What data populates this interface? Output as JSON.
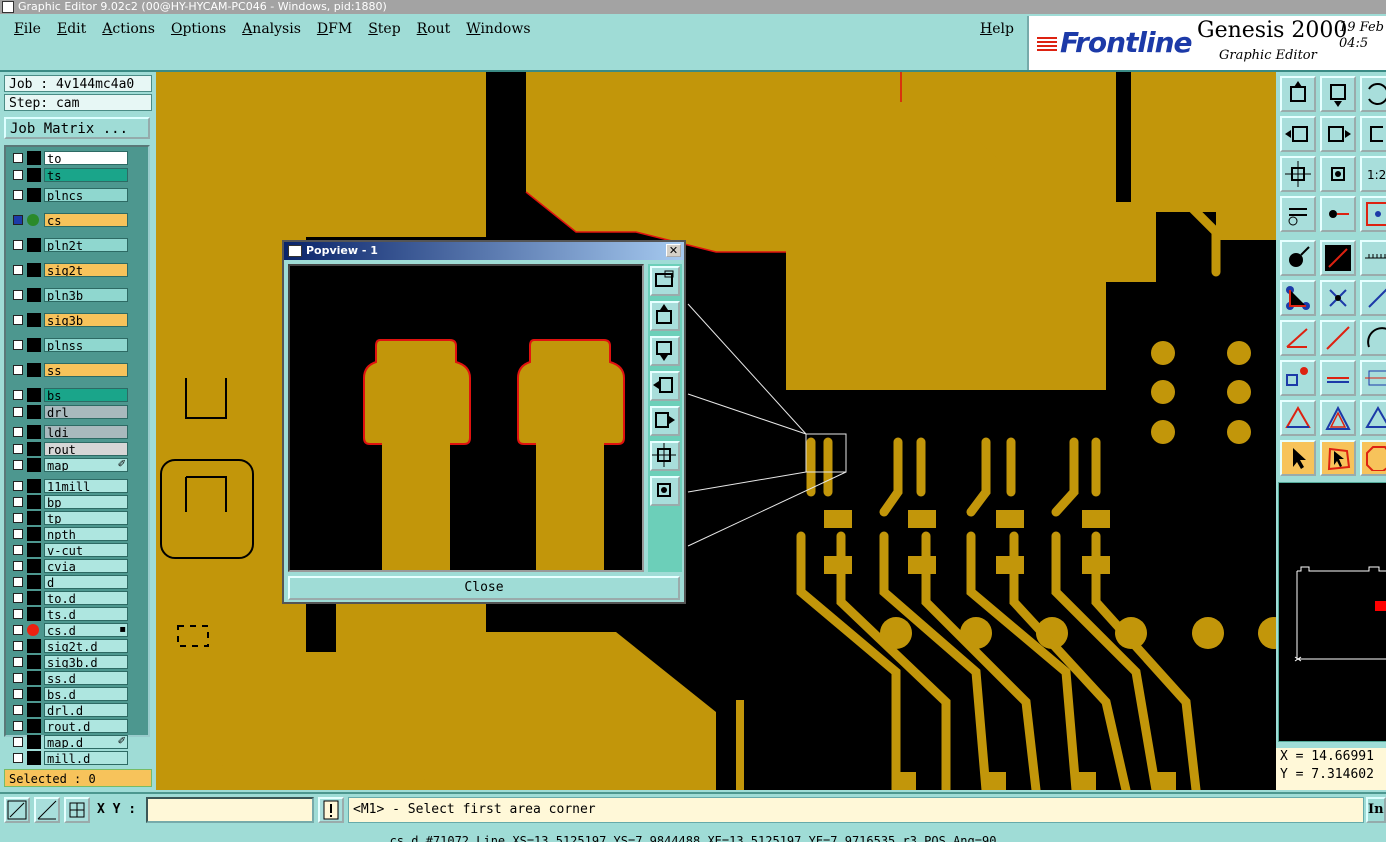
{
  "window": {
    "title": "Graphic Editor 9.02c2 (00@HY-HYCAM-PC046 - Windows, pid:1880)"
  },
  "menubar": {
    "items": [
      "File",
      "Edit",
      "Actions",
      "Options",
      "Analysis",
      "DFM",
      "Step",
      "Rout",
      "Windows"
    ],
    "help": "Help"
  },
  "brand": {
    "logo": "Frontline",
    "product": "Genesis 2000",
    "subtitle": "Graphic Editor",
    "date": "19 Feb",
    "time": "04:5"
  },
  "job": {
    "job": "Job : 4v144mc4a0",
    "step": "Step: cam",
    "matrix_button": "Job Matrix ..."
  },
  "layers": [
    {
      "name": "to",
      "color": "white",
      "marker": "black"
    },
    {
      "name": "ts",
      "color": "green",
      "marker": "black"
    },
    {
      "name": "plncs",
      "color": "teal",
      "marker": "black"
    },
    {
      "name": "cs",
      "color": "orange",
      "marker": "green-dot"
    },
    {
      "name": "pln2t",
      "color": "teal",
      "marker": "black"
    },
    {
      "name": "sig2t",
      "color": "orange",
      "marker": "black"
    },
    {
      "name": "pln3b",
      "color": "teal",
      "marker": "black"
    },
    {
      "name": "sig3b",
      "color": "orange",
      "marker": "black"
    },
    {
      "name": "plnss",
      "color": "teal",
      "marker": "black"
    },
    {
      "name": "ss",
      "color": "orange",
      "marker": "black"
    },
    {
      "name": "bs",
      "color": "green",
      "marker": "black"
    },
    {
      "name": "drl",
      "color": "slate",
      "marker": "black"
    },
    {
      "name": "ldi",
      "color": "slate",
      "marker": "black"
    },
    {
      "name": "rout",
      "color": "gray",
      "marker": "black"
    },
    {
      "name": "map",
      "color": "pale",
      "marker": "black",
      "flag": "✐"
    },
    {
      "name": "11mill",
      "color": "pale",
      "marker": "black"
    },
    {
      "name": "bp",
      "color": "pale",
      "marker": "black"
    },
    {
      "name": "tp",
      "color": "pale",
      "marker": "black"
    },
    {
      "name": "npth",
      "color": "pale",
      "marker": "black"
    },
    {
      "name": "v-cut",
      "color": "pale",
      "marker": "black"
    },
    {
      "name": "cvia",
      "color": "pale",
      "marker": "black"
    },
    {
      "name": "d",
      "color": "pale",
      "marker": "black"
    },
    {
      "name": "to.d",
      "color": "pale",
      "marker": "black"
    },
    {
      "name": "ts.d",
      "color": "pale",
      "marker": "black"
    },
    {
      "name": "cs.d",
      "color": "pale",
      "marker": "red-dot",
      "flag": "▪"
    },
    {
      "name": "sig2t.d",
      "color": "pale",
      "marker": "black"
    },
    {
      "name": "sig3b.d",
      "color": "pale",
      "marker": "black"
    },
    {
      "name": "ss.d",
      "color": "pale",
      "marker": "black"
    },
    {
      "name": "bs.d",
      "color": "pale",
      "marker": "black"
    },
    {
      "name": "drl.d",
      "color": "pale",
      "marker": "black"
    },
    {
      "name": "rout.d",
      "color": "pale",
      "marker": "black"
    },
    {
      "name": "map.d",
      "color": "pale",
      "marker": "black",
      "flag": "✐"
    },
    {
      "name": "mill.d",
      "color": "pale",
      "marker": "black"
    }
  ],
  "selected": "Selected : 0",
  "popview": {
    "title": "Popview - 1",
    "close_x": "✕",
    "close_button": "Close"
  },
  "coords": {
    "x": "X = 14.66991",
    "y": "Y = 7.314602"
  },
  "bottom": {
    "xy_label": "X Y :",
    "xy_value": "",
    "prompt": "<M1> - Select first area corner",
    "right_button": "In"
  },
  "status": "cs.d #71072 Line XS=13.5125197 YS=7.9844488 XE=13.5125197 YE=7.9716535 r3 POS Ang=90",
  "colors": {
    "copper": "#c2960a",
    "board": "#000000",
    "outline": "#e0120f",
    "panel": "#9fdcd6"
  }
}
